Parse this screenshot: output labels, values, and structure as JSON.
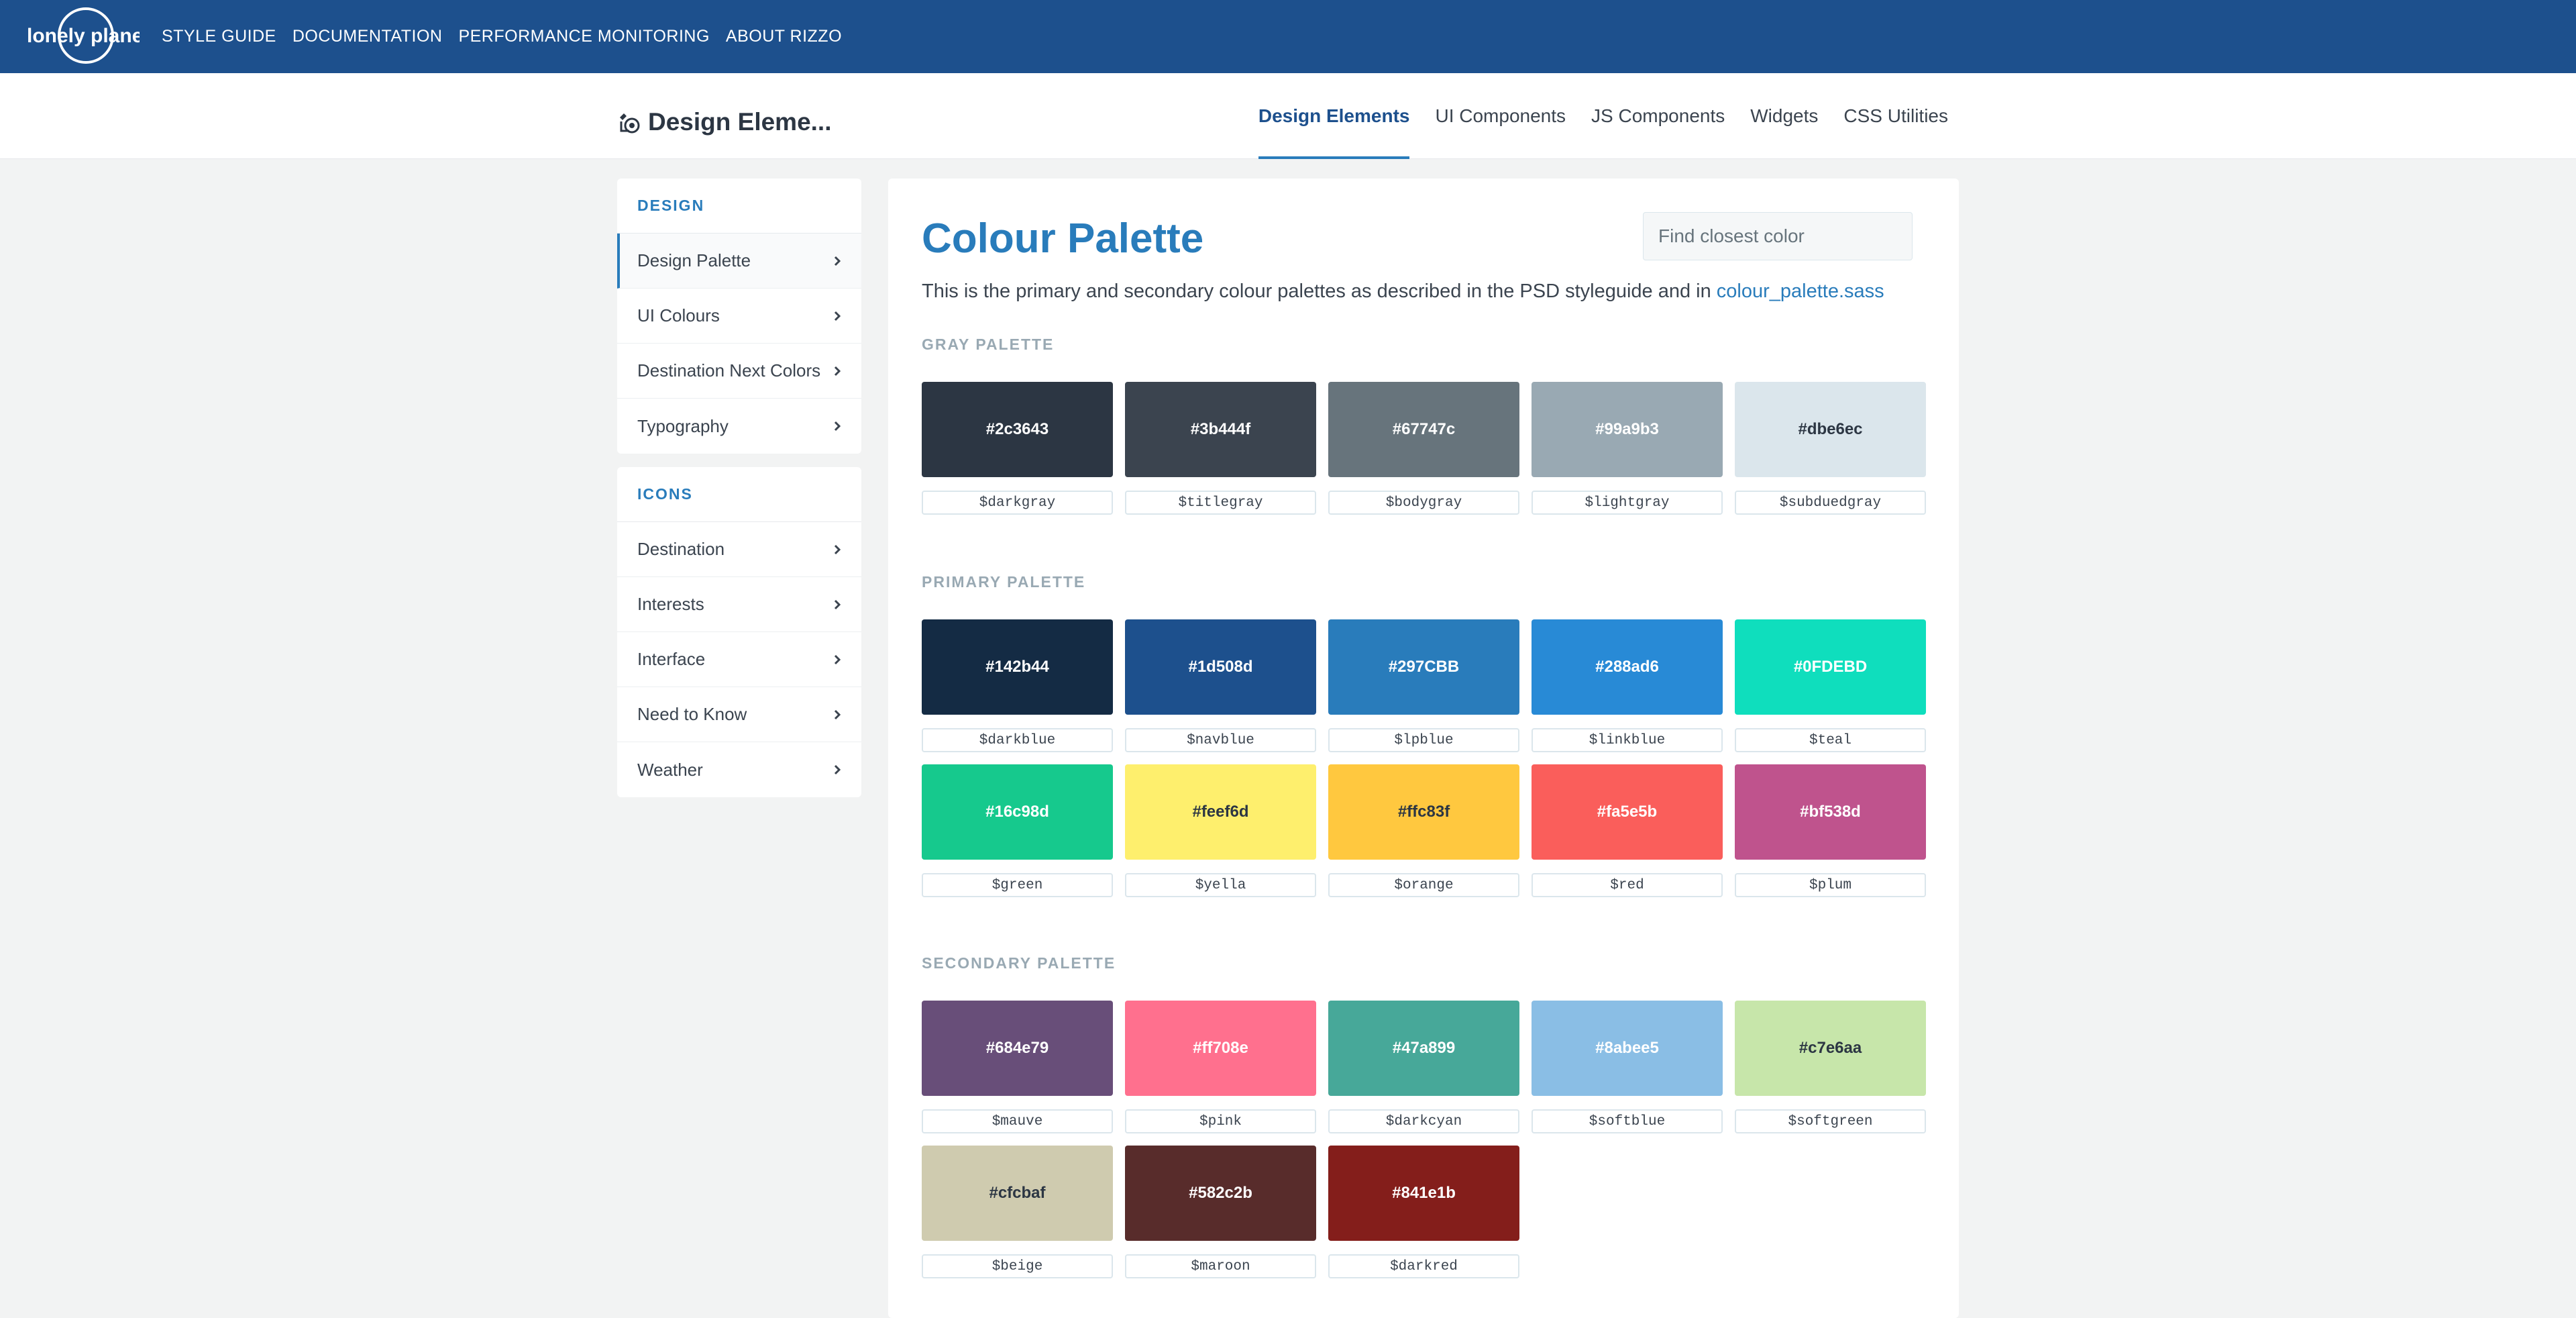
{
  "topnav": {
    "logo_text": "lonely planet",
    "items": [
      "STYLE GUIDE",
      "DOCUMENTATION",
      "PERFORMANCE MONITORING",
      "ABOUT RIZZO"
    ]
  },
  "subbar": {
    "title": "Design Eleme...",
    "tabs": [
      {
        "label": "Design Elements",
        "active": true
      },
      {
        "label": "UI Components",
        "active": false
      },
      {
        "label": "JS Components",
        "active": false
      },
      {
        "label": "Widgets",
        "active": false
      },
      {
        "label": "CSS Utilities",
        "active": false
      }
    ]
  },
  "sidebar": {
    "design": {
      "heading": "DESIGN",
      "items": [
        "Design Palette",
        "UI Colours",
        "Destination Next Colors",
        "Typography"
      ]
    },
    "icons": {
      "heading": "ICONS",
      "items": [
        "Destination",
        "Interests",
        "Interface",
        "Need to Know",
        "Weather"
      ]
    }
  },
  "main": {
    "title": "Colour Palette",
    "search_placeholder": "Find closest color",
    "intro_text": "This is the primary and secondary colour palettes as described in the PSD styleguide and in ",
    "intro_link": "colour_palette.sass",
    "sections": [
      {
        "label": "GRAY PALETTE",
        "swatches": [
          {
            "hex": "#2c3643",
            "var": "$darkgray"
          },
          {
            "hex": "#3b444f",
            "var": "$titlegray"
          },
          {
            "hex": "#67747c",
            "var": "$bodygray"
          },
          {
            "hex": "#99a9b3",
            "var": "$lightgray"
          },
          {
            "hex": "#dbe6ec",
            "var": "$subduedgray"
          }
        ]
      },
      {
        "label": "PRIMARY PALETTE",
        "swatches": [
          {
            "hex": "#142b44",
            "var": "$darkblue"
          },
          {
            "hex": "#1d508d",
            "var": "$navblue"
          },
          {
            "hex": "#297CBB",
            "var": "$lpblue"
          },
          {
            "hex": "#288ad6",
            "var": "$linkblue"
          },
          {
            "hex": "#0FDEBD",
            "var": "$teal"
          },
          {
            "hex": "#16c98d",
            "var": "$green"
          },
          {
            "hex": "#feef6d",
            "var": "$yella"
          },
          {
            "hex": "#ffc83f",
            "var": "$orange"
          },
          {
            "hex": "#fa5e5b",
            "var": "$red"
          },
          {
            "hex": "#bf538d",
            "var": "$plum"
          }
        ]
      },
      {
        "label": "SECONDARY PALETTE",
        "swatches": [
          {
            "hex": "#684e79",
            "var": "$mauve"
          },
          {
            "hex": "#ff708e",
            "var": "$pink"
          },
          {
            "hex": "#47a899",
            "var": "$darkcyan"
          },
          {
            "hex": "#8abee5",
            "var": "$softblue"
          },
          {
            "hex": "#c7e6aa",
            "var": "$softgreen"
          },
          {
            "hex": "#cfcbaf",
            "var": "$beige"
          },
          {
            "hex": "#582c2b",
            "var": "$maroon"
          },
          {
            "hex": "#841e1b",
            "var": "$darkred"
          }
        ]
      }
    ]
  }
}
